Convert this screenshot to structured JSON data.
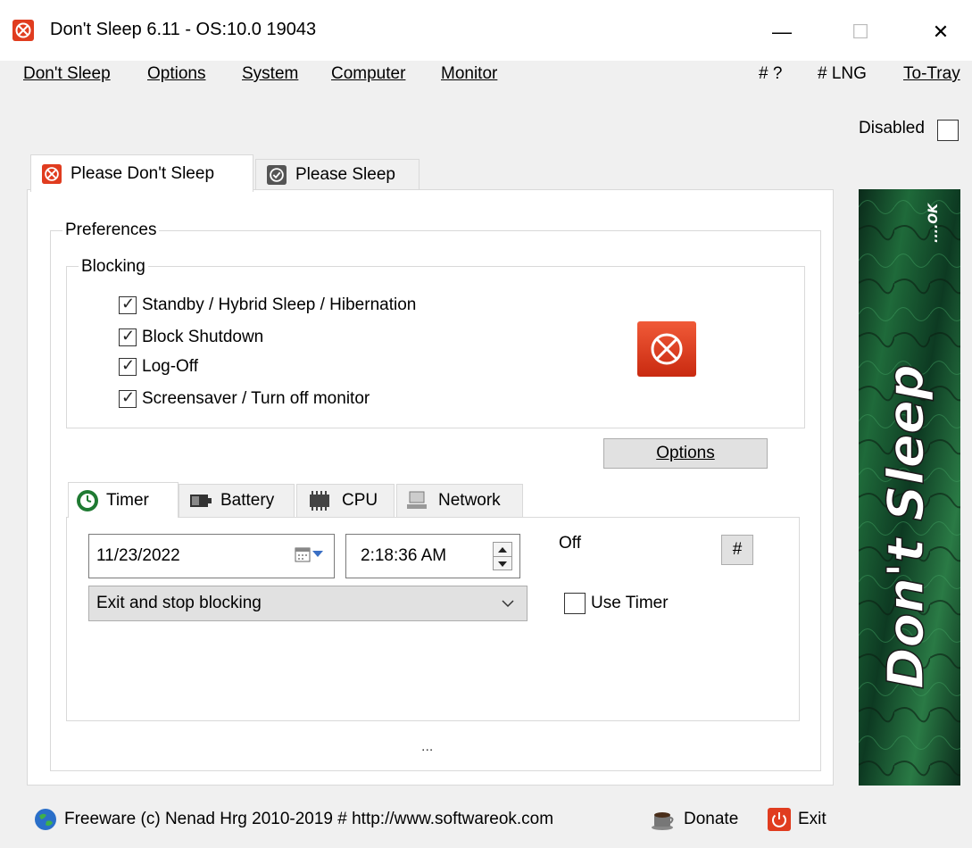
{
  "window": {
    "title": "Don't Sleep 6.11 - OS:10.0 19043",
    "minimize_glyph": "—",
    "maximize_glyph": "☐",
    "close_glyph": "✕"
  },
  "menu": {
    "items": [
      "Don't Sleep",
      "Options",
      "System",
      "Computer",
      "Monitor"
    ],
    "right_items": [
      "# ?",
      "# LNG",
      "To-Tray"
    ]
  },
  "disabled": {
    "label": "Disabled",
    "checked": false
  },
  "tabs": {
    "dont_sleep": "Please Don't Sleep",
    "sleep": "Please Sleep"
  },
  "preferences": {
    "title": "Preferences",
    "blocking": {
      "title": "Blocking",
      "items": [
        {
          "label": "Standby / Hybrid Sleep / Hibernation",
          "checked": true
        },
        {
          "label": "Block Shutdown",
          "checked": true
        },
        {
          "label": "Log-Off",
          "checked": true
        },
        {
          "label": "Screensaver / Turn off monitor",
          "checked": true
        }
      ]
    },
    "options_button": "Options"
  },
  "subtabs": {
    "timer": "Timer",
    "battery": "Battery",
    "cpu": "CPU",
    "network": "Network"
  },
  "timer": {
    "date": "11/23/2022",
    "time": "2:18:36 AM",
    "status": "Off",
    "hash_button": "#",
    "action": "Exit and stop blocking",
    "use_timer_label": "Use Timer",
    "use_timer_checked": false
  },
  "panel_ellipsis": "...",
  "banner": {
    "text": "Don't Sleep",
    "ok": "....OK"
  },
  "footer": {
    "freeware": "Freeware (c) Nenad Hrg 2010-2019 # http://www.softwareok.com",
    "donate": "Donate",
    "exit": "Exit"
  },
  "colors": {
    "accent_red": "#e03c1f",
    "banner_green": "#2ecc40"
  }
}
